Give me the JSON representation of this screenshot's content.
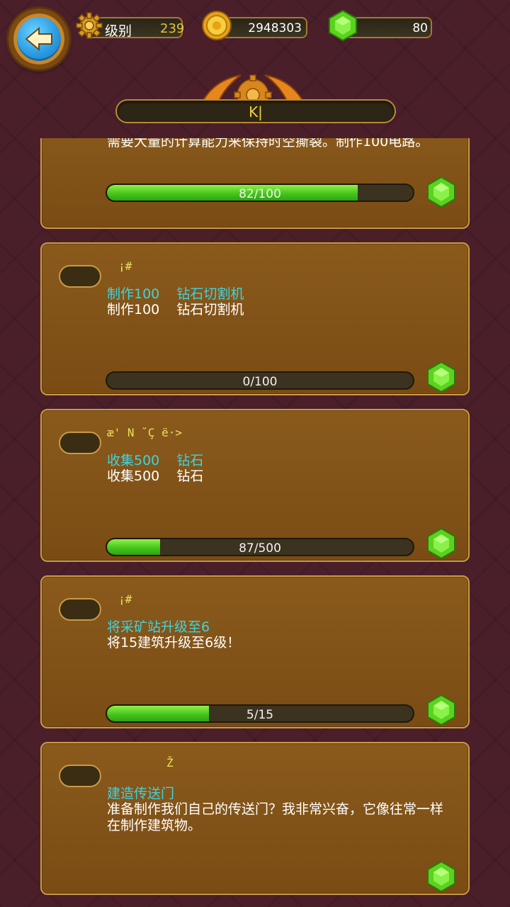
{
  "header": {
    "level_label": "级别",
    "level_value": "239",
    "coins": "2948303",
    "gems": "80",
    "title": "K|"
  },
  "colors": {
    "background": "#4a1f2a",
    "card": "#8a5a1c",
    "progress_fill": "#47c51c",
    "title_text": "#f2d23c",
    "quest_title": "#3fd3e0"
  },
  "icons": {
    "back": "arrow-left-icon",
    "level": "gear-icon",
    "coins": "gold-coin-icon",
    "gems": "green-gem-icon"
  },
  "quests": [
    {
      "tag": "",
      "title": "",
      "desc": "需要大量的计算能力来保持时空撕裂。制作100电路。",
      "progress_text": "82/100",
      "progress": 0.82
    },
    {
      "tag": "¡#",
      "title": "制作100    钻石切割机",
      "desc": "制作100    钻石切割机",
      "progress_text": "0/100",
      "progress": 0
    },
    {
      "tag": "æ'  N   ˘Ç ë·>",
      "title": "收集500    钻石",
      "desc": "收集500    钻石",
      "progress_text": "87/500",
      "progress": 0.174
    },
    {
      "tag": "¡#",
      "title": "将采矿站升级至6",
      "desc": "将15建筑升级至6级！",
      "progress_text": "5/15",
      "progress": 0.333
    },
    {
      "tag": "Ž",
      "title": "建造传送门",
      "desc": "准备制作我们自己的传送门？我非常兴奋，它像往常一样在制作建筑物。",
      "progress_text": "",
      "progress": null
    }
  ]
}
